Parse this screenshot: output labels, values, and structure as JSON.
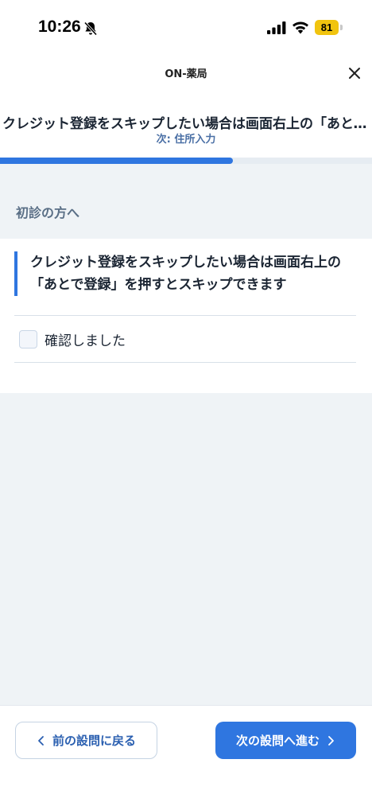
{
  "status_bar": {
    "time": "10:26",
    "battery": "81"
  },
  "header": {
    "app_title": "ON-薬局",
    "question_title": "クレジット登録をスキップしたい場合は画面右上の「あとで登録」を押すとスキップできます",
    "next_step": "次: 住所入力"
  },
  "progress": {
    "fraction": 0.625
  },
  "section": {
    "heading": "初診の方へ"
  },
  "notice": {
    "text": "クレジット登録をスキップしたい場合は画面右上の「あとで登録」を押すとスキップできます"
  },
  "confirm": {
    "label": "確認しました",
    "checked": false
  },
  "footer": {
    "prev_label": "前の設問に戻る",
    "next_label": "次の設問へ進む"
  },
  "colors": {
    "accent": "#2f76e0",
    "background": "#eff3f6",
    "text": "#1b2533"
  }
}
